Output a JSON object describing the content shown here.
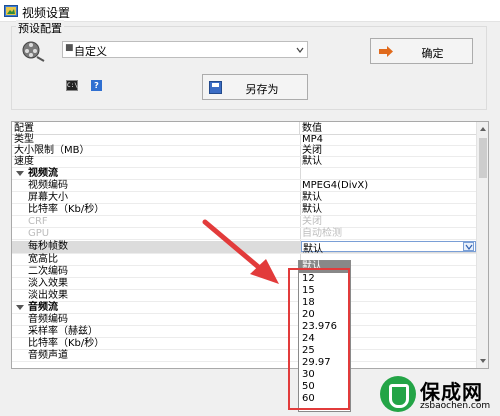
{
  "window": {
    "title": "视频设置"
  },
  "preset": {
    "group_title": "预设配置",
    "selected_value": "自定义",
    "ok_label": "确定",
    "save_as_label": "另存为"
  },
  "grid": {
    "header": {
      "name": "配置",
      "value": "数值"
    },
    "rows": [
      {
        "name": "类型",
        "value": "MP4"
      },
      {
        "name": "大小限制（MB）",
        "value": "关闭"
      },
      {
        "name": "速度",
        "value": "默认"
      },
      {
        "name": "视频流",
        "value": ""
      },
      {
        "name": "视频编码",
        "value": "MPEG4(DivX)"
      },
      {
        "name": "屏幕大小",
        "value": "默认"
      },
      {
        "name": "比特率（Kb/秒）",
        "value": "默认"
      },
      {
        "name": "CRF",
        "value": "关闭"
      },
      {
        "name": "GPU",
        "value": "自动检测"
      },
      {
        "name": "每秒帧数",
        "value": "默认"
      },
      {
        "name": "宽高比",
        "value": ""
      },
      {
        "name": "二次编码",
        "value": ""
      },
      {
        "name": "淡入效果",
        "value": ""
      },
      {
        "name": "淡出效果",
        "value": ""
      },
      {
        "name": "音频流",
        "value": ""
      },
      {
        "name": "音频编码",
        "value": ""
      },
      {
        "name": "采样率（赫兹）",
        "value": ""
      },
      {
        "name": "比特率（Kb/秒）",
        "value": ""
      },
      {
        "name": "音频声道",
        "value": ""
      }
    ]
  },
  "fps_dropdown": {
    "options": [
      "默认",
      "12",
      "15",
      "18",
      "20",
      "23.976",
      "24",
      "25",
      "29.97",
      "30",
      "50",
      "60"
    ],
    "selected": "默认"
  },
  "watermark": {
    "name": "保成网",
    "url": "zsbaochen.com"
  },
  "colors": {
    "annotation_red": "#e23b3b",
    "watermark_green": "#23a446"
  }
}
